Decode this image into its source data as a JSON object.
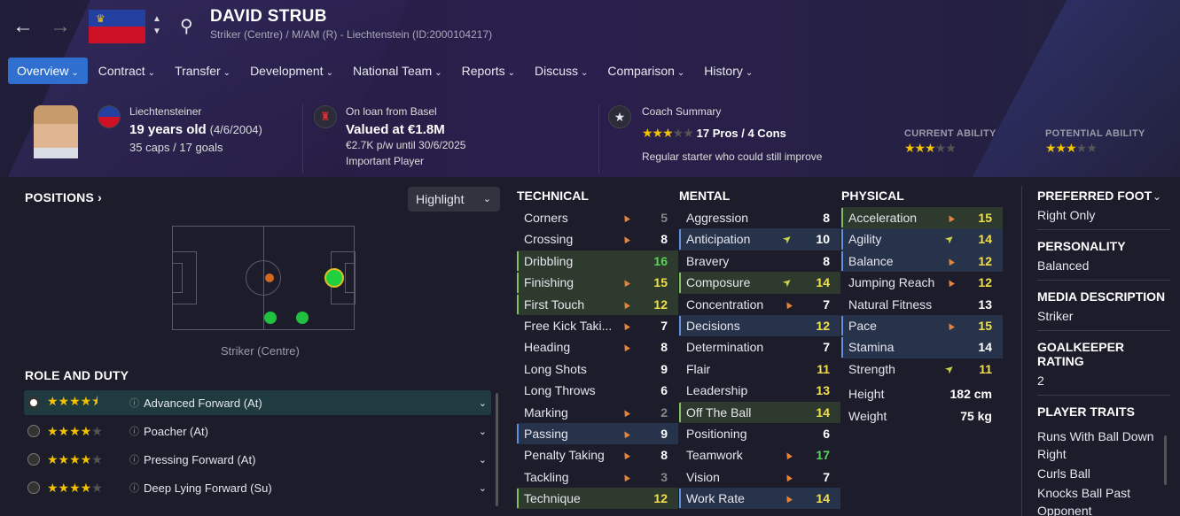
{
  "header": {
    "name": "DAVID STRUB",
    "subtitle": "Striker (Centre) / M/AM (R) - Liechtenstein (ID:2000104217)"
  },
  "tabs": [
    {
      "label": "Overview"
    },
    {
      "label": "Contract"
    },
    {
      "label": "Transfer"
    },
    {
      "label": "Development"
    },
    {
      "label": "National Team"
    },
    {
      "label": "Reports"
    },
    {
      "label": "Discuss"
    },
    {
      "label": "Comparison"
    },
    {
      "label": "History"
    }
  ],
  "info": {
    "nationality": "Liechtensteiner",
    "age": "19 years old",
    "dob": "(4/6/2004)",
    "caps": "35 caps / 17 goals",
    "loan": "On loan from Basel",
    "value": "Valued at €1.8M",
    "wage": "€2.7K p/w until 30/6/2025",
    "status": "Important Player",
    "coach_title": "Coach Summary",
    "pros_cons": "17 Pros / 4 Cons",
    "coach_text": "Regular starter who could still improve",
    "current_ability_label": "CURRENT ABILITY",
    "potential_ability_label": "POTENTIAL ABILITY",
    "current_ability_stars": 3,
    "potential_ability_stars": 3,
    "coach_stars": 3
  },
  "positions": {
    "title": "POSITIONS",
    "highlight_label": "Highlight",
    "caption": "Striker (Centre)"
  },
  "roles": {
    "title": "ROLE AND DUTY",
    "items": [
      {
        "label": "Advanced Forward (At)",
        "stars": 4.5
      },
      {
        "label": "Poacher (At)",
        "stars": 4
      },
      {
        "label": "Pressing Forward (At)",
        "stars": 4
      },
      {
        "label": "Deep Lying Forward (Su)",
        "stars": 4
      }
    ]
  },
  "technical": {
    "title": "TECHNICAL",
    "rows": [
      {
        "name": "Corners",
        "value": "5"
      },
      {
        "name": "Crossing",
        "value": "8"
      },
      {
        "name": "Dribbling",
        "value": "16"
      },
      {
        "name": "Finishing",
        "value": "15"
      },
      {
        "name": "First Touch",
        "value": "12"
      },
      {
        "name": "Free Kick Taki...",
        "value": "7"
      },
      {
        "name": "Heading",
        "value": "8"
      },
      {
        "name": "Long Shots",
        "value": "9"
      },
      {
        "name": "Long Throws",
        "value": "6"
      },
      {
        "name": "Marking",
        "value": "2"
      },
      {
        "name": "Passing",
        "value": "9"
      },
      {
        "name": "Penalty Taking",
        "value": "8"
      },
      {
        "name": "Tackling",
        "value": "3"
      },
      {
        "name": "Technique",
        "value": "12"
      }
    ]
  },
  "mental": {
    "title": "MENTAL",
    "rows": [
      {
        "name": "Aggression",
        "value": "8"
      },
      {
        "name": "Anticipation",
        "value": "10"
      },
      {
        "name": "Bravery",
        "value": "8"
      },
      {
        "name": "Composure",
        "value": "14"
      },
      {
        "name": "Concentration",
        "value": "7"
      },
      {
        "name": "Decisions",
        "value": "12"
      },
      {
        "name": "Determination",
        "value": "7"
      },
      {
        "name": "Flair",
        "value": "11"
      },
      {
        "name": "Leadership",
        "value": "13"
      },
      {
        "name": "Off The Ball",
        "value": "14"
      },
      {
        "name": "Positioning",
        "value": "6"
      },
      {
        "name": "Teamwork",
        "value": "17"
      },
      {
        "name": "Vision",
        "value": "7"
      },
      {
        "name": "Work Rate",
        "value": "14"
      }
    ]
  },
  "physical": {
    "title": "PHYSICAL",
    "rows": [
      {
        "name": "Acceleration",
        "value": "15"
      },
      {
        "name": "Agility",
        "value": "14"
      },
      {
        "name": "Balance",
        "value": "12"
      },
      {
        "name": "Jumping Reach",
        "value": "12"
      },
      {
        "name": "Natural Fitness",
        "value": "13"
      },
      {
        "name": "Pace",
        "value": "15"
      },
      {
        "name": "Stamina",
        "value": "14"
      },
      {
        "name": "Strength",
        "value": "11"
      }
    ],
    "height_label": "Height",
    "height": "182 cm",
    "weight_label": "Weight",
    "weight": "75 kg"
  },
  "right_panel": {
    "foot_label": "PREFERRED FOOT",
    "foot": "Right Only",
    "personality_label": "PERSONALITY",
    "personality": "Balanced",
    "media_label": "MEDIA DESCRIPTION",
    "media": "Striker",
    "gk_label": "GOALKEEPER RATING",
    "gk": "2",
    "traits_label": "PLAYER TRAITS",
    "traits": [
      "Runs With Ball Down Right",
      "Curls Ball",
      "Knocks Ball Past Opponent"
    ]
  }
}
